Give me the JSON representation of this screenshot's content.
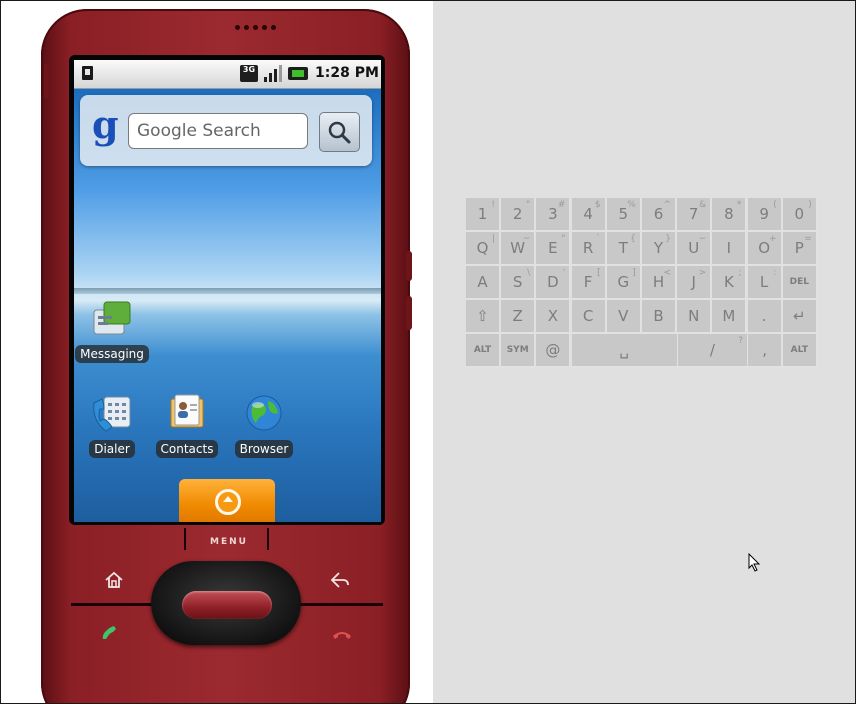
{
  "status_bar": {
    "network": "3G",
    "time": "1:28 PM",
    "icons": [
      "sd-card-icon",
      "network-3g-icon",
      "signal-icon",
      "battery-icon"
    ]
  },
  "search_widget": {
    "logo": "g",
    "placeholder": "Google Search",
    "button_icon": "magnifier-icon"
  },
  "apps": {
    "messaging": "Messaging",
    "dialer": "Dialer",
    "contacts": "Contacts",
    "browser": "Browser"
  },
  "hardware": {
    "menu_label": "MENU",
    "buttons": [
      "home-icon",
      "back-icon",
      "call-icon",
      "end-call-icon"
    ]
  },
  "keyboard": {
    "rows": [
      [
        {
          "k": "1",
          "a": "!"
        },
        {
          "k": "2",
          "a": "\""
        },
        {
          "k": "3",
          "a": "#"
        },
        {
          "k": "4",
          "a": "$"
        },
        {
          "k": "5",
          "a": "%"
        },
        {
          "k": "6",
          "a": "^"
        },
        {
          "k": "7",
          "a": "&"
        },
        {
          "k": "8",
          "a": "*"
        },
        {
          "k": "9",
          "a": "("
        },
        {
          "k": "0",
          "a": ")"
        }
      ],
      [
        {
          "k": "Q",
          "a": "|"
        },
        {
          "k": "W",
          "a": "~"
        },
        {
          "k": "E",
          "a": "\""
        },
        {
          "k": "R",
          "a": "`"
        },
        {
          "k": "T",
          "a": "{"
        },
        {
          "k": "Y",
          "a": "}"
        },
        {
          "k": "U",
          "a": "−"
        },
        {
          "k": "I",
          "a": ""
        },
        {
          "k": "O",
          "a": "+"
        },
        {
          "k": "P",
          "a": "="
        }
      ],
      [
        {
          "k": "A",
          "a": ""
        },
        {
          "k": "S",
          "a": "\\"
        },
        {
          "k": "D",
          "a": "'"
        },
        {
          "k": "F",
          "a": "["
        },
        {
          "k": "G",
          "a": "]"
        },
        {
          "k": "H",
          "a": "<"
        },
        {
          "k": "J",
          "a": ">"
        },
        {
          "k": "K",
          "a": ";"
        },
        {
          "k": "L",
          "a": ":"
        },
        {
          "k": "DEL",
          "a": ""
        }
      ],
      [
        {
          "k": "⇧",
          "a": ""
        },
        {
          "k": "Z",
          "a": ""
        },
        {
          "k": "X",
          "a": ""
        },
        {
          "k": "C",
          "a": ""
        },
        {
          "k": "V",
          "a": ""
        },
        {
          "k": "B",
          "a": ""
        },
        {
          "k": "N",
          "a": ""
        },
        {
          "k": "M",
          "a": ""
        },
        {
          "k": ".",
          "a": ""
        },
        {
          "k": "↵",
          "a": ""
        }
      ]
    ],
    "bottom_row": {
      "alt_left": "ALT",
      "sym": "SYM",
      "at": "@",
      "space": "␣",
      "slash": "/",
      "slash_alt": "?",
      "comma": ",",
      "alt_right": "ALT"
    }
  },
  "colors": {
    "phone_body": "#9b2a30",
    "drawer_handle": "#f08a00",
    "keyboard_key": "#c8c8c8",
    "background": "#e0e0e0"
  }
}
